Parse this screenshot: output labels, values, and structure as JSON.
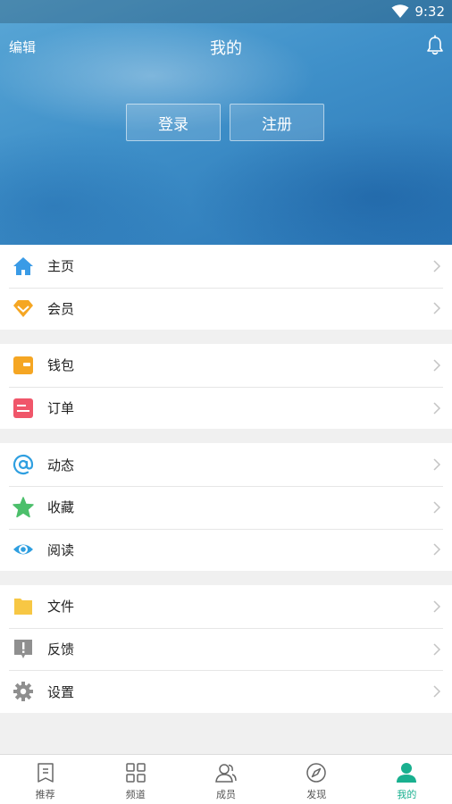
{
  "status": {
    "time": "9:32"
  },
  "header": {
    "edit_label": "编辑",
    "title": "我的",
    "login_label": "登录",
    "register_label": "注册"
  },
  "menu": {
    "group1": [
      {
        "label": "主页",
        "icon": "home-icon"
      },
      {
        "label": "会员",
        "icon": "diamond-icon"
      }
    ],
    "group2": [
      {
        "label": "钱包",
        "icon": "wallet-icon"
      },
      {
        "label": "订单",
        "icon": "order-icon"
      }
    ],
    "group3": [
      {
        "label": "动态",
        "icon": "at-icon"
      },
      {
        "label": "收藏",
        "icon": "star-icon"
      },
      {
        "label": "阅读",
        "icon": "eye-icon"
      }
    ],
    "group4": [
      {
        "label": "文件",
        "icon": "folder-icon"
      },
      {
        "label": "反馈",
        "icon": "feedback-icon"
      },
      {
        "label": "设置",
        "icon": "gear-icon"
      }
    ]
  },
  "tabs": [
    {
      "label": "推荐",
      "icon": "recommend-icon"
    },
    {
      "label": "频道",
      "icon": "grid-icon"
    },
    {
      "label": "成员",
      "icon": "members-icon"
    },
    {
      "label": "发现",
      "icon": "compass-icon"
    },
    {
      "label": "我的",
      "icon": "user-icon",
      "active": true
    }
  ],
  "colors": {
    "accent": "#19b08f",
    "home": "#3a9be6",
    "diamond": "#f5a623",
    "wallet": "#f5a623",
    "order": "#f0566a",
    "at": "#2f9fe0",
    "star": "#4cbf6b",
    "eye": "#2f9fe0",
    "folder": "#f7c744",
    "feedback": "#8f8f8f",
    "gear": "#8f8f8f"
  }
}
